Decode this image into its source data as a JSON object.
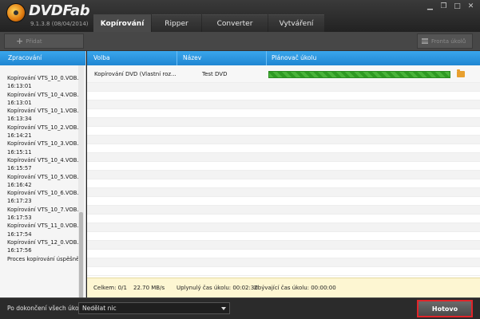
{
  "app": {
    "brand": "DVDFab",
    "version": "9.1.3.8 (08/04/2014)",
    "tabs": [
      "Kopírování",
      "Ripper",
      "Converter",
      "Vytváření"
    ],
    "window_controls": [
      "minimize-icon",
      "restore-icon",
      "maximize-icon",
      "close-icon"
    ]
  },
  "toolbar": {
    "add_label": "Přidat",
    "queue_label": "Fronta úkolů"
  },
  "left_panel": {
    "header": "Zpracování",
    "log": [
      "Kopírování VTS_10_0.VOB...",
      "16:13:01",
      "Kopírování VTS_10_4.VOB...",
      "16:13:01",
      "Kopírování VTS_10_1.VOB...",
      "16:13:34",
      "Kopírování VTS_10_2.VOB...",
      "16:14:21",
      "Kopírování VTS_10_3.VOB...",
      "16:15:11",
      "Kopírování VTS_10_4.VOB...",
      "16:15:57",
      "Kopírování VTS_10_5.VOB...",
      "16:16:42",
      "Kopírování VTS_10_6.VOB...",
      "16:17:23",
      "Kopírování VTS_10_7.VOB...",
      "16:17:53",
      "Kopírování VTS_11_0.VOB...",
      "16:17:54",
      "Kopírování VTS_12_0.VOB...",
      "16:17:56",
      "Proces kopírování úspěšně dc"
    ]
  },
  "table": {
    "columns": [
      "Volba",
      "Název",
      "Plánovač úkolu"
    ],
    "rows": [
      {
        "volba": "Kopírování DVD (Vlastní roz...",
        "nazev": "Test DVD",
        "progress": 1.0,
        "action_icon": "folder-icon"
      }
    ]
  },
  "status": {
    "total": "Celkem: 0/1",
    "speed": "22.70 MB/s",
    "elapsed": "Uplynulý čas úkolu: 00:02:30",
    "remaining": "Zbývající čas úkolu: 00:00:00"
  },
  "bottom": {
    "label": "Po dokončení všech úkolů:",
    "select_value": "Nedělat nic",
    "done_label": "Hotovo"
  },
  "colors": {
    "header_blue": "#2592dd",
    "progress_green": "#3aa82e",
    "done_border": "#e0252a",
    "status_bg": "#fdf6d2"
  }
}
